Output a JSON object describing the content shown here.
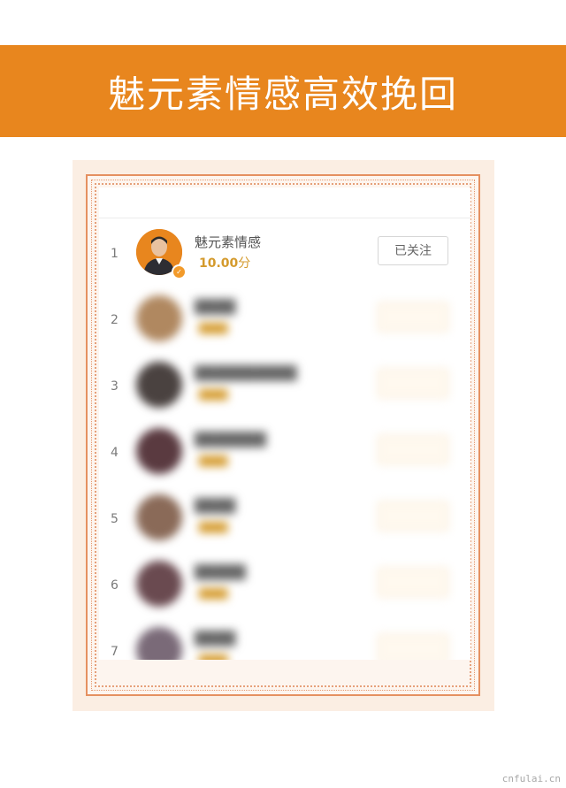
{
  "banner": {
    "title": "魅元素情感高效挽回"
  },
  "ranking": [
    {
      "rank": "1",
      "name": "魅元素情感",
      "score": "10.00",
      "score_unit": "分",
      "button": "已关注",
      "blurred": false
    },
    {
      "rank": "2",
      "name": "",
      "score": "",
      "score_unit": "",
      "button": "",
      "blurred": true
    },
    {
      "rank": "3",
      "name": "",
      "score": "",
      "score_unit": "",
      "button": "",
      "blurred": true
    },
    {
      "rank": "4",
      "name": "",
      "score": "",
      "score_unit": "",
      "button": "",
      "blurred": true
    },
    {
      "rank": "5",
      "name": "",
      "score": "",
      "score_unit": "",
      "button": "",
      "blurred": true
    },
    {
      "rank": "6",
      "name": "",
      "score": "",
      "score_unit": "",
      "button": "",
      "blurred": true
    },
    {
      "rank": "7",
      "name": "",
      "score": "",
      "score_unit": "",
      "button": "",
      "blurred": true
    }
  ],
  "watermark": "cnfulai.cn",
  "colors": {
    "banner": "#e8861e",
    "frame": "#e59060",
    "score": "#d49a2c"
  },
  "icons": {
    "verified_badge": "check-badge-icon"
  }
}
